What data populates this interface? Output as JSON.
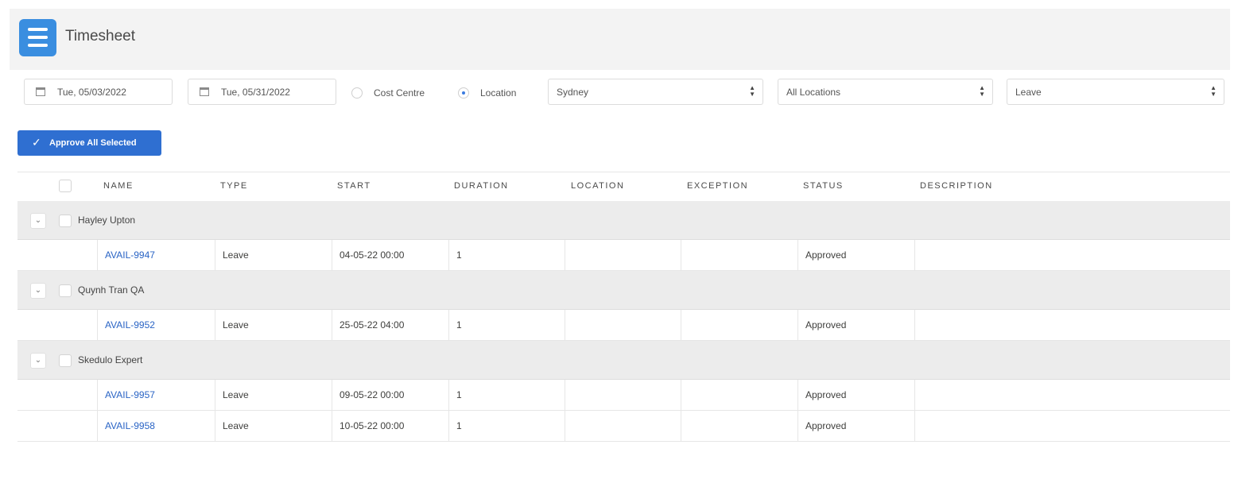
{
  "header": {
    "title": "Timesheet",
    "icon": "list-menu-icon",
    "icon_color": "#3a8ee0"
  },
  "filters": {
    "start_date": "Tue, 05/03/2022",
    "end_date": "Tue, 05/31/2022",
    "group_by_options": [
      {
        "label": "Cost Centre",
        "selected": false
      },
      {
        "label": "Location",
        "selected": true
      }
    ],
    "region_select": "Sydney",
    "location_select": "All Locations",
    "type_select": "Leave"
  },
  "approve_button": {
    "label": "Approve All Selected",
    "color": "#2f6fd1"
  },
  "table": {
    "columns": [
      "NAME",
      "TYPE",
      "START",
      "DURATION",
      "LOCATION",
      "EXCEPTION",
      "STATUS",
      "DESCRIPTION"
    ],
    "groups": [
      {
        "name": "Hayley Upton",
        "rows": [
          {
            "name": "AVAIL-9947",
            "type": "Leave",
            "start": "04-05-22 00:00",
            "duration": "1",
            "location": "",
            "exception": "",
            "status": "Approved",
            "description": ""
          }
        ]
      },
      {
        "name": "Quynh Tran QA",
        "rows": [
          {
            "name": "AVAIL-9952",
            "type": "Leave",
            "start": "25-05-22 04:00",
            "duration": "1",
            "location": "",
            "exception": "",
            "status": "Approved",
            "description": ""
          }
        ]
      },
      {
        "name": "Skedulo Expert",
        "rows": [
          {
            "name": "AVAIL-9957",
            "type": "Leave",
            "start": "09-05-22 00:00",
            "duration": "1",
            "location": "",
            "exception": "",
            "status": "Approved",
            "description": ""
          },
          {
            "name": "AVAIL-9958",
            "type": "Leave",
            "start": "10-05-22 00:00",
            "duration": "1",
            "location": "",
            "exception": "",
            "status": "Approved",
            "description": ""
          }
        ]
      }
    ]
  }
}
